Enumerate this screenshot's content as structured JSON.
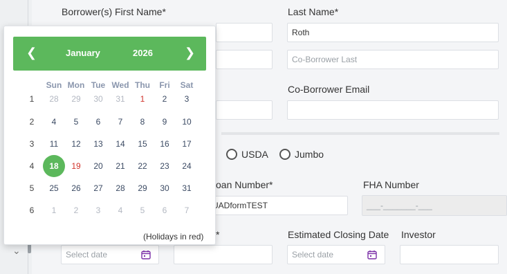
{
  "form": {
    "first_name_label": "Borrower(s) First Name*",
    "last_name_label": "Last Name*",
    "last_name_value": "Roth",
    "co_borrower_last_placeholder": "Co-Borrower Last",
    "co_borrower_email_label": "Co-Borrower Email",
    "loan_type_options": [
      "USDA",
      "Jumbo"
    ],
    "loan_number_label": "oan Number*",
    "loan_number_value": "UADformTEST",
    "fha_number_label": "FHA Number",
    "fha_number_placeholder": "___-_______-___",
    "asterisk_label": "*",
    "estimated_closing_label": "Estimated Closing Date",
    "investor_label": "Investor",
    "select_date_placeholder": "Select date"
  },
  "calendar": {
    "month": "January",
    "year": "2026",
    "prev_glyph": "❮",
    "next_glyph": "❯",
    "weekdays": [
      "Sun",
      "Mon",
      "Tue",
      "Wed",
      "Thu",
      "Fri",
      "Sat"
    ],
    "selected_day": "18",
    "holidays_note": "(Holidays in red)",
    "weeks": [
      {
        "num": "1",
        "days": [
          {
            "d": "28",
            "type": "other"
          },
          {
            "d": "29",
            "type": "other"
          },
          {
            "d": "30",
            "type": "other"
          },
          {
            "d": "31",
            "type": "other"
          },
          {
            "d": "1",
            "type": "holiday"
          },
          {
            "d": "2",
            "type": "normal"
          },
          {
            "d": "3",
            "type": "normal"
          }
        ]
      },
      {
        "num": "2",
        "days": [
          {
            "d": "4",
            "type": "normal"
          },
          {
            "d": "5",
            "type": "normal"
          },
          {
            "d": "6",
            "type": "normal"
          },
          {
            "d": "7",
            "type": "normal"
          },
          {
            "d": "8",
            "type": "normal"
          },
          {
            "d": "9",
            "type": "normal"
          },
          {
            "d": "10",
            "type": "normal"
          }
        ]
      },
      {
        "num": "3",
        "days": [
          {
            "d": "11",
            "type": "normal"
          },
          {
            "d": "12",
            "type": "normal"
          },
          {
            "d": "13",
            "type": "normal"
          },
          {
            "d": "14",
            "type": "normal"
          },
          {
            "d": "15",
            "type": "normal"
          },
          {
            "d": "16",
            "type": "normal"
          },
          {
            "d": "17",
            "type": "normal"
          }
        ]
      },
      {
        "num": "4",
        "days": [
          {
            "d": "18",
            "type": "selected"
          },
          {
            "d": "19",
            "type": "holiday"
          },
          {
            "d": "20",
            "type": "normal"
          },
          {
            "d": "21",
            "type": "normal"
          },
          {
            "d": "22",
            "type": "normal"
          },
          {
            "d": "23",
            "type": "normal"
          },
          {
            "d": "24",
            "type": "normal"
          }
        ]
      },
      {
        "num": "5",
        "days": [
          {
            "d": "25",
            "type": "normal"
          },
          {
            "d": "26",
            "type": "normal"
          },
          {
            "d": "27",
            "type": "normal"
          },
          {
            "d": "28",
            "type": "normal"
          },
          {
            "d": "29",
            "type": "normal"
          },
          {
            "d": "30",
            "type": "normal"
          },
          {
            "d": "31",
            "type": "normal"
          }
        ]
      },
      {
        "num": "6",
        "days": [
          {
            "d": "1",
            "type": "other"
          },
          {
            "d": "2",
            "type": "other"
          },
          {
            "d": "3",
            "type": "other"
          },
          {
            "d": "4",
            "type": "other"
          },
          {
            "d": "5",
            "type": "other"
          },
          {
            "d": "6",
            "type": "other"
          },
          {
            "d": "7",
            "type": "other"
          }
        ]
      }
    ]
  },
  "colors": {
    "accent_green": "#5cb85c",
    "holiday_red": "#d0332b",
    "calendar_icon_purple": "#7b2fa8"
  },
  "icons": {
    "calendar": "calendar-icon",
    "dropdown": "chevron-down-icon"
  }
}
